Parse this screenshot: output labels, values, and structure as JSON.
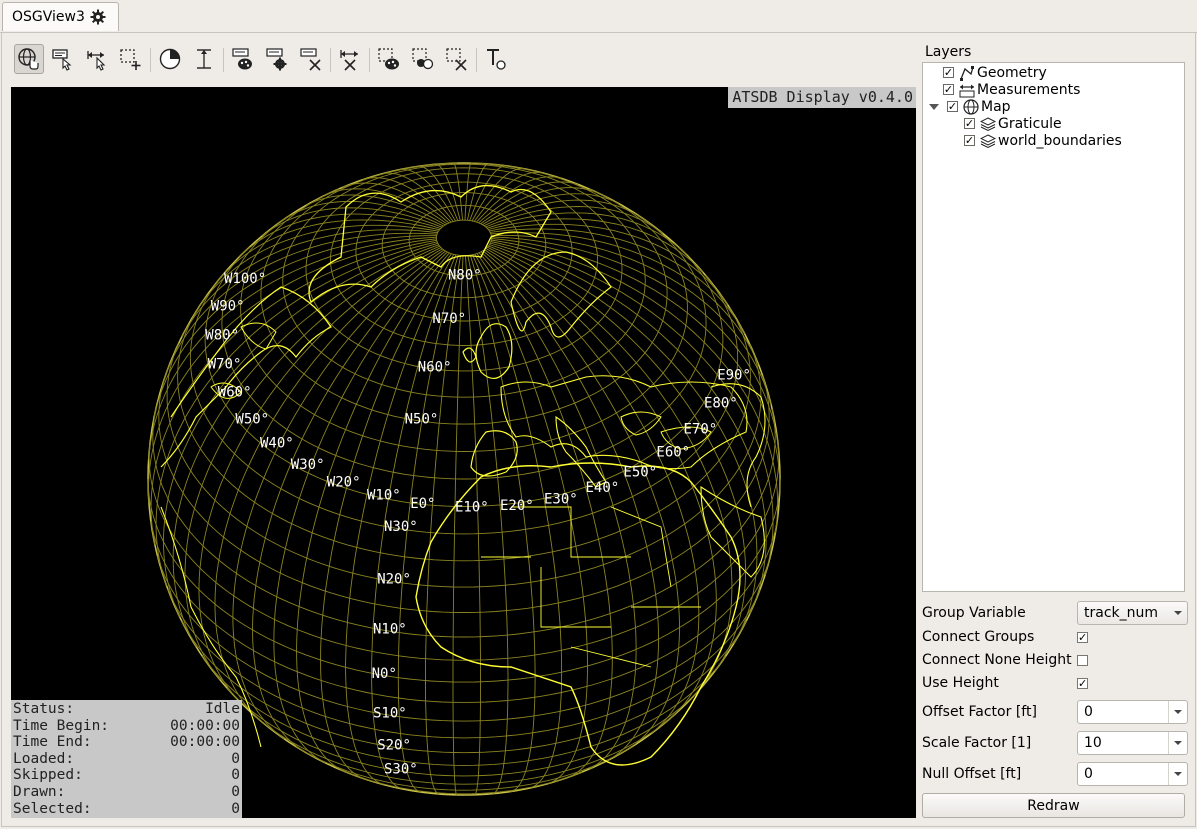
{
  "tab": {
    "title": "OSGView3",
    "icon": "gear-icon"
  },
  "toolbar": {
    "buttons": [
      {
        "name": "navigate-tool-button",
        "icon": "globe-hand-icon",
        "active": true
      },
      {
        "name": "label-tool-button",
        "icon": "label-pointer-icon",
        "active": false
      },
      {
        "name": "measure-tool-button",
        "icon": "measure-arrow-icon",
        "active": false
      },
      {
        "name": "select-add-tool-button",
        "icon": "select-plus-icon",
        "active": false
      },
      {
        "name": "time-filter-tool-button",
        "icon": "clock-pie-icon",
        "active": false
      },
      {
        "name": "height-tool-button",
        "icon": "height-bar-icon",
        "active": false
      },
      {
        "name": "label-style-tool-button",
        "icon": "palette-icon",
        "active": false
      },
      {
        "name": "label-settings-tool-button",
        "icon": "gear-icon",
        "active": false
      },
      {
        "name": "label-delete-tool-button",
        "icon": "cross-icon",
        "active": false
      },
      {
        "name": "measure-delete-tool-button",
        "icon": "cross-icon",
        "active": false
      },
      {
        "name": "select-style-tool-button",
        "icon": "palette-icon",
        "active": false
      },
      {
        "name": "select-settings-tool-button",
        "icon": "settings-icon",
        "active": false
      },
      {
        "name": "select-delete-tool-button",
        "icon": "cross-icon",
        "active": false
      },
      {
        "name": "text-tool-button",
        "icon": "text-icon",
        "active": false
      }
    ]
  },
  "view": {
    "badge": "ATSDB Display v0.4.0",
    "status": [
      {
        "label": "Status:",
        "value": "Idle"
      },
      {
        "label": "Time Begin:",
        "value": "00:00:00"
      },
      {
        "label": "Time End:",
        "value": "00:00:00"
      },
      {
        "label": "Loaded:",
        "value": "0"
      },
      {
        "label": "Skipped:",
        "value": "0"
      },
      {
        "label": "Drawn:",
        "value": "0"
      },
      {
        "label": "Selected:",
        "value": "0"
      }
    ],
    "graticule_labels": {
      "lat": [
        "N80°",
        "N70°",
        "N60°",
        "N50°",
        "N30°",
        "N20°",
        "N10°",
        "N0°",
        "S10°",
        "S20°",
        "S30°"
      ],
      "lon": [
        "W100°",
        "W90°",
        "W80°",
        "W70°",
        "W60°",
        "W50°",
        "W40°",
        "W30°",
        "W20°",
        "W10°",
        "E0°",
        "E10°",
        "E20°",
        "E30°",
        "E40°",
        "E50°",
        "E60°",
        "E70°",
        "E80°",
        "E90°"
      ]
    },
    "colors": {
      "background": "#000000",
      "graticule": "#8a8420",
      "coastline": "#ffff33"
    }
  },
  "layers": {
    "title": "Layers",
    "items": [
      {
        "label": "Geometry",
        "checked": true,
        "icon": "geometry-icon"
      },
      {
        "label": "Measurements",
        "checked": true,
        "icon": "measure-icon"
      },
      {
        "label": "Map",
        "checked": true,
        "icon": "globe-icon",
        "expanded": true
      },
      {
        "label": "Graticule",
        "checked": true,
        "icon": "layers-icon"
      },
      {
        "label": "world_boundaries",
        "checked": true,
        "icon": "layers-icon"
      }
    ]
  },
  "props": {
    "group_variable": {
      "label": "Group Variable",
      "value": "track_num"
    },
    "connect_groups": {
      "label": "Connect Groups",
      "checked": true
    },
    "connect_none_height": {
      "label": "Connect None Height",
      "checked": false
    },
    "use_height": {
      "label": "Use Height",
      "checked": true
    },
    "offset_factor": {
      "label": "Offset Factor [ft]",
      "value": "0"
    },
    "scale_factor": {
      "label": "Scale Factor [1]",
      "value": "10"
    },
    "null_offset": {
      "label": "Null Offset [ft]",
      "value": "0"
    },
    "redraw_label": "Redraw"
  }
}
